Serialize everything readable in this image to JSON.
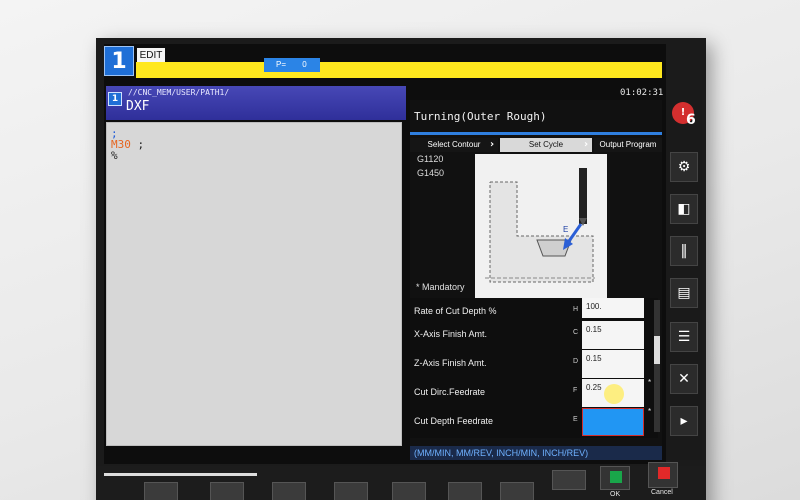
{
  "header": {
    "mode_number": "1",
    "mode_tab": "EDIT",
    "p_label": "P=",
    "p_value": "0",
    "time": "01:02:31"
  },
  "program": {
    "path_number": "1",
    "path": "//CNC_MEM/USER/PATH1/",
    "file_name": "DXF",
    "lines": [
      ";",
      "M30",
      " ;",
      "%"
    ]
  },
  "cycle": {
    "title": "Turning(Outer Rough)",
    "steps": [
      "Select Contour",
      "Set Cycle",
      "Output Program"
    ],
    "g_codes": [
      "G1120",
      "G1450"
    ],
    "diagram_label": "E",
    "mandatory_note": "* Mandatory"
  },
  "params": [
    {
      "label": "Rate of Cut Depth %",
      "letter": "H",
      "value": "100.",
      "required": false
    },
    {
      "label": "X-Axis Finish Amt.",
      "letter": "C",
      "value": "0.15",
      "required": false
    },
    {
      "label": "Z-Axis Finish Amt.",
      "letter": "D",
      "value": "0.15",
      "required": false
    },
    {
      "label": "Cut Dirc.Feedrate",
      "letter": "F",
      "value": "0.25",
      "required": true
    },
    {
      "label": "Cut Depth Feedrate",
      "letter": "E",
      "value": "",
      "required": true
    }
  ],
  "units_hint": "(MM/MIN, MM/REV, INCH/MIN, INCH/REV)",
  "sidebar": {
    "alarm_count": "6",
    "alarm_icon": "!"
  },
  "footer": {
    "ok_label": "OK",
    "cancel_label": "Cancel"
  },
  "colors": {
    "mode_blue": "#1f6fd6",
    "header_yellow": "#ffe81e",
    "active_field": "#2196f3",
    "ok_green": "#19a64a",
    "cancel_red": "#e12929"
  }
}
